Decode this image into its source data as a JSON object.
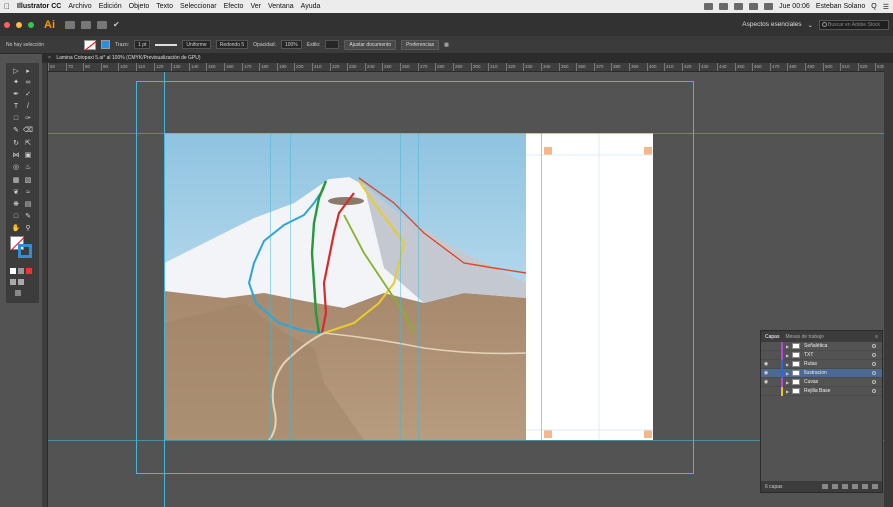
{
  "menubar": {
    "apple": "",
    "app": "Illustrator CC",
    "items": [
      "Archivo",
      "Edición",
      "Objeto",
      "Texto",
      "Seleccionar",
      "Efecto",
      "Ver",
      "Ventana",
      "Ayuda"
    ],
    "clock": "Jue 00:06",
    "user": "Esteban Solano",
    "search": "Q",
    "list": "☰"
  },
  "appbar": {
    "logo": "Ai",
    "workspace": "Aspectos esenciales",
    "search_placeholder": "Buscar en Adobe Stock"
  },
  "control": {
    "selection": "No hay selección",
    "stroke_label": "Trazo:",
    "stroke_value": "1 pt",
    "profile": "Uniforme",
    "brush": "Redondo 5",
    "opacity_label": "Opacidad:",
    "opacity_value": "100%",
    "style_label": "Estilo:",
    "doc_setup": "Ajustar documento",
    "prefs": "Preferencias"
  },
  "document": {
    "tab_title": "Lamina Cotopaxi 5.ai* al 100% (CMYK/Previsualización de GPU)"
  },
  "ruler": {
    "labels": [
      "50",
      "70",
      "80",
      "90",
      "100",
      "110",
      "120",
      "130",
      "140",
      "150",
      "160",
      "170",
      "180",
      "190",
      "200",
      "210",
      "220",
      "230",
      "240",
      "250",
      "260",
      "270",
      "280",
      "290",
      "300",
      "310",
      "320",
      "330",
      "340",
      "350",
      "360",
      "370",
      "380",
      "390",
      "400",
      "410",
      "420",
      "430",
      "440",
      "450",
      "460",
      "470",
      "480",
      "490",
      "500",
      "510",
      "520",
      "530"
    ]
  },
  "layers": {
    "tab_active": "Capas",
    "tab_inactive": "Mesas de trabajo",
    "count": "6 capas",
    "items": [
      {
        "name": "Señalética",
        "color": "#b646d8",
        "visible": false
      },
      {
        "name": "TXT",
        "color": "#b646d8",
        "visible": false
      },
      {
        "name": "Rutas",
        "color": "#3566d9",
        "visible": true
      },
      {
        "name": "Ilustracion",
        "color": "#3566d9",
        "visible": true
      },
      {
        "name": "Cuvas",
        "color": "#b646d8",
        "visible": true
      },
      {
        "name": "Rejilla Base",
        "color": "#e6c52a",
        "visible": false
      }
    ]
  },
  "colors": {
    "accent": "#2e8fd8",
    "guide": "#43b6d9",
    "sky_top": "#8fc3e0",
    "earth": "#a88a6c"
  }
}
